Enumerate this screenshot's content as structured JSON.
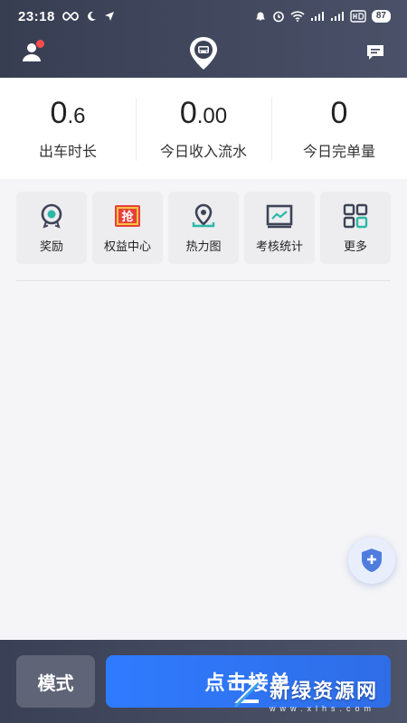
{
  "status_bar": {
    "time": "23:18",
    "left_icons": [
      "infinity-icon",
      "moon-icon",
      "navigation-icon"
    ],
    "right_icons": [
      "bell-off-icon",
      "alarm-icon",
      "wifi-icon",
      "signal-4g-icon",
      "signal-4g-icon",
      "hd-icon"
    ],
    "battery": "87"
  },
  "nav": {
    "left_icon": "profile-icon",
    "center_icon": "car-logo-icon",
    "right_icon": "message-icon"
  },
  "stats": [
    {
      "int": "0",
      "dec": ".6",
      "label": "出车时长"
    },
    {
      "int": "0",
      "dec": ".00",
      "label": "今日收入流水"
    },
    {
      "int": "0",
      "dec": "",
      "label": "今日完单量"
    }
  ],
  "tiles": [
    {
      "label": "奖励",
      "icon": "reward-icon"
    },
    {
      "label": "权益中心",
      "icon": "grab-badge-icon",
      "icon_text": "抢"
    },
    {
      "label": "热力图",
      "icon": "location-pin-icon"
    },
    {
      "label": "考核统计",
      "icon": "chart-icon"
    },
    {
      "label": "更多",
      "icon": "grid-icon"
    }
  ],
  "fab": {
    "icon": "shield-plus-icon"
  },
  "bottom": {
    "mode_label": "模式",
    "accept_label": "点击接单"
  },
  "watermark": {
    "title": "新绿资源网",
    "url": "www.xlhs.com"
  },
  "colors": {
    "header_bg": "#3d4357",
    "accent_blue": "#2f7bff",
    "notification_red": "#ff4d4f",
    "teal": "#2bb8a6"
  }
}
